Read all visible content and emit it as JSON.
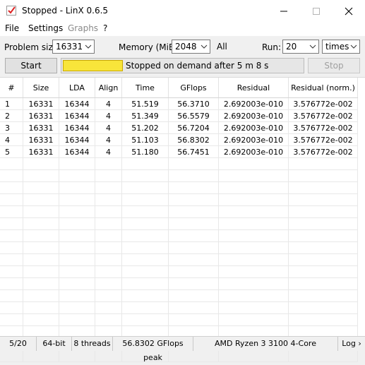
{
  "window": {
    "title": "Stopped - LinX 0.6.5"
  },
  "menu": {
    "file": "File",
    "settings": "Settings",
    "graphs": "Graphs",
    "help": "?"
  },
  "controls": {
    "problem_size_label": "Problem size:",
    "problem_size_value": "16331",
    "memory_label": "Memory (MiB):",
    "memory_value": "2048",
    "all_label": "All",
    "run_label": "Run:",
    "run_value": "20",
    "run_unit": "times"
  },
  "actions": {
    "start_label": "Start",
    "stop_label": "Stop",
    "status_text": "Stopped on demand after 5 m 8 s",
    "progress_fraction": 0.25,
    "progress_color": "#f8e53a"
  },
  "table": {
    "headers": [
      "#",
      "Size",
      "LDA",
      "Align",
      "Time",
      "GFlops",
      "Residual",
      "Residual (norm.)"
    ],
    "rows": [
      [
        "1",
        "16331",
        "16344",
        "4",
        "51.519",
        "56.3710",
        "2.692003e-010",
        "3.576772e-002"
      ],
      [
        "2",
        "16331",
        "16344",
        "4",
        "51.349",
        "56.5579",
        "2.692003e-010",
        "3.576772e-002"
      ],
      [
        "3",
        "16331",
        "16344",
        "4",
        "51.202",
        "56.7204",
        "2.692003e-010",
        "3.576772e-002"
      ],
      [
        "4",
        "16331",
        "16344",
        "4",
        "51.103",
        "56.8302",
        "2.692003e-010",
        "3.576772e-002"
      ],
      [
        "5",
        "16331",
        "16344",
        "4",
        "51.180",
        "56.7451",
        "2.692003e-010",
        "3.576772e-002"
      ]
    ]
  },
  "statusbar": {
    "runs": "5/20",
    "bits": "64-bit",
    "threads": "8 threads",
    "peak": "56.8302 GFlops peak",
    "cpu": "AMD Ryzen 3 3100 4-Core",
    "log": "Log ›"
  }
}
